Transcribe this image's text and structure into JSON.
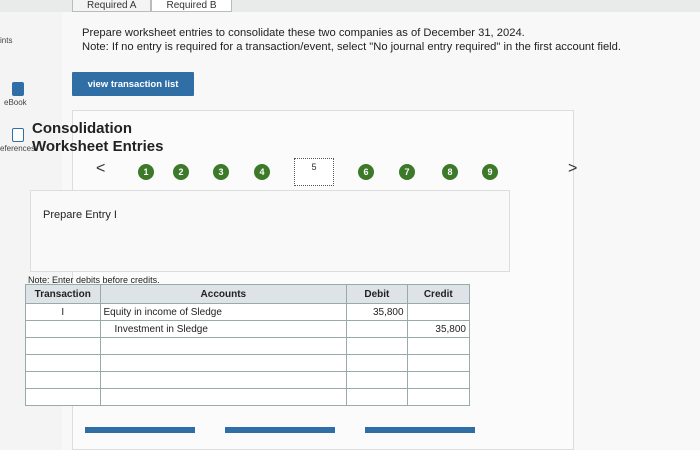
{
  "tabs": [
    "Required A",
    "Required B"
  ],
  "rail": {
    "item0": "ints",
    "item1": "eBook",
    "item2": "eferences"
  },
  "instructions": {
    "line1": "Prepare worksheet entries to consolidate these two companies as of December 31, 2024.",
    "line2": "Note: If no entry is required for a transaction/event, select \"No journal entry required\" in the first account field."
  },
  "view_transaction_label": "view transaction list",
  "title": {
    "line1": "Consolidation",
    "line2": "Worksheet Entries"
  },
  "steps": [
    "1",
    "2",
    "3",
    "4",
    "5",
    "6",
    "7",
    "8",
    "9"
  ],
  "current_step": "5",
  "prev_arrow": "<",
  "next_arrow": ">",
  "entry_label": "Prepare Entry I",
  "note": "Note: Enter debits before credits.",
  "table": {
    "headers": [
      "Transaction",
      "Accounts",
      "Debit",
      "Credit"
    ],
    "rows": [
      [
        "I",
        "Equity in income of Sledge",
        "35,800",
        ""
      ],
      [
        "",
        "Investment in Sledge",
        "",
        "35,800"
      ],
      [
        "",
        "",
        "",
        ""
      ],
      [
        "",
        "",
        "",
        ""
      ],
      [
        "",
        "",
        "",
        ""
      ],
      [
        "",
        "",
        "",
        ""
      ]
    ]
  },
  "colors": {
    "accent": "#2f6fa6",
    "step": "#3c7a2a"
  }
}
